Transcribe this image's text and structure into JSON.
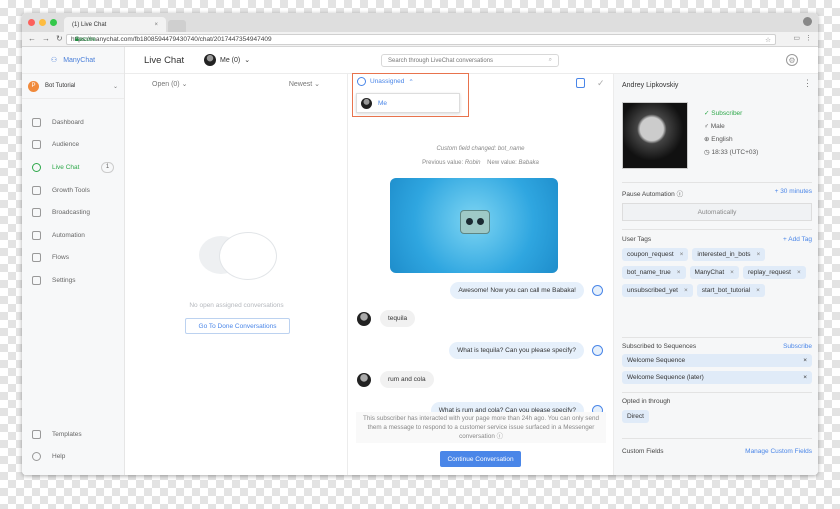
{
  "browser": {
    "tab_title": "(1) Live Chat",
    "secure_label": "Secure",
    "url": "https://manychat.com/fb180859447943074​0/chat/2017447354947409"
  },
  "sidebar": {
    "brand": "ManyChat",
    "bot_name": "Bot Tutorial",
    "bot_avatar_letter": "P",
    "items": [
      {
        "label": "Dashboard",
        "icon": "home-icon"
      },
      {
        "label": "Audience",
        "icon": "users-icon"
      },
      {
        "label": "Live Chat",
        "icon": "chat-icon",
        "badge": "1"
      },
      {
        "label": "Growth Tools",
        "icon": "growth-icon"
      },
      {
        "label": "Broadcasting",
        "icon": "send-icon"
      },
      {
        "label": "Automation",
        "icon": "robot-icon"
      },
      {
        "label": "Flows",
        "icon": "folder-icon"
      },
      {
        "label": "Settings",
        "icon": "gear-icon"
      }
    ],
    "bottom": [
      {
        "label": "Templates",
        "icon": "template-icon"
      },
      {
        "label": "Help",
        "icon": "help-icon"
      }
    ]
  },
  "header": {
    "title": "Live Chat",
    "me_label": "Me (0)",
    "search_placeholder": "Search through LiveChat conversations"
  },
  "conversations": {
    "filter": "Open (0)",
    "sort": "Newest",
    "empty_text": "No open assigned conversations",
    "done_button": "Go To Done Conversations"
  },
  "chat": {
    "assign_label": "Unassigned",
    "dropdown_option": "Me",
    "system_line1": "Custom field changed: bot_name",
    "system_prev_label": "Previous value:",
    "system_prev_value": "Robin",
    "system_new_label": "New value:",
    "system_new_value": "Babaka",
    "messages": [
      {
        "dir": "out",
        "text": "Awesome! Now you can call me Babaka!"
      },
      {
        "dir": "in",
        "text": "tequila"
      },
      {
        "dir": "out",
        "text": "What is tequila? Can you please specify?"
      },
      {
        "dir": "in",
        "text": "rum and cola"
      },
      {
        "dir": "out",
        "text": "What is rum and cola? Can you please specify?"
      }
    ],
    "notice": "This subscriber has interacted with your page more than 24h ago. You can only send them a message to respond to a customer service issue surfaced in a Messenger conversation ⓘ",
    "continue_button": "Continue Conversation"
  },
  "profile": {
    "name": "Andrey Lipkovskiy",
    "status": "Subscriber",
    "gender": "Male",
    "language": "English",
    "time": "18:33 (UTC+03)",
    "pause_label": "Pause Automation",
    "pause_link": "+ 30 minutes",
    "pause_value": "Automatically",
    "tags_label": "User Tags",
    "add_tag": "+ Add Tag",
    "tags": [
      "coupon_request",
      "interested_in_bots",
      "bot_name_true",
      "ManyChat",
      "replay_request",
      "unsubscribed_yet",
      "start_bot_tutorial"
    ],
    "sequences_label": "Subscribed to Sequences",
    "subscribe_link": "Subscribe",
    "sequences": [
      "Welcome Sequence",
      "Welcome Sequence (later)"
    ],
    "opted_label": "Opted in through",
    "opted_value": "Direct",
    "custom_label": "Custom Fields",
    "manage_link": "Manage Custom Fields"
  },
  "colors": {
    "accent": "#4a86e8",
    "active": "#2ea84a",
    "highlight": "#e8734d"
  }
}
